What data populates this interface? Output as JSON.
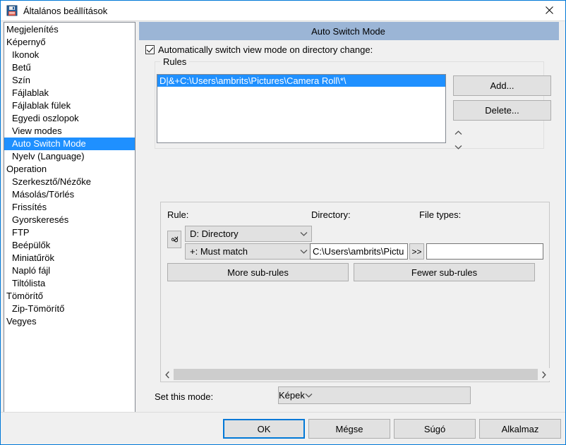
{
  "window": {
    "title": "Általános beállítások",
    "icon": "save-floppy-icon",
    "close_label": "✕"
  },
  "sidebar": {
    "items": [
      {
        "label": "Megjelenítés",
        "level": 0,
        "selected": false
      },
      {
        "label": "Képernyő",
        "level": 0,
        "selected": false
      },
      {
        "label": "Ikonok",
        "level": 1,
        "selected": false
      },
      {
        "label": "Betű",
        "level": 1,
        "selected": false
      },
      {
        "label": "Szín",
        "level": 1,
        "selected": false
      },
      {
        "label": "Fájlablak",
        "level": 1,
        "selected": false
      },
      {
        "label": "Fájlablak fülek",
        "level": 1,
        "selected": false
      },
      {
        "label": "Egyedi oszlopok",
        "level": 1,
        "selected": false
      },
      {
        "label": "View modes",
        "level": 1,
        "selected": false
      },
      {
        "label": "Auto Switch Mode",
        "level": 1,
        "selected": true
      },
      {
        "label": "Nyelv (Language)",
        "level": 1,
        "selected": false
      },
      {
        "label": "Operation",
        "level": 0,
        "selected": false
      },
      {
        "label": "Szerkesztő/Nézőke",
        "level": 1,
        "selected": false
      },
      {
        "label": "Másolás/Törlés",
        "level": 1,
        "selected": false
      },
      {
        "label": "Frissítés",
        "level": 1,
        "selected": false
      },
      {
        "label": "Gyorskeresés",
        "level": 1,
        "selected": false
      },
      {
        "label": "FTP",
        "level": 1,
        "selected": false
      },
      {
        "label": "Beépülők",
        "level": 1,
        "selected": false
      },
      {
        "label": "Miniatűrök",
        "level": 1,
        "selected": false
      },
      {
        "label": "Napló fájl",
        "level": 1,
        "selected": false
      },
      {
        "label": "Tiltólista",
        "level": 1,
        "selected": false
      },
      {
        "label": "Tömörítő",
        "level": 0,
        "selected": false
      },
      {
        "label": "Zip-Tömörítő",
        "level": 1,
        "selected": false
      },
      {
        "label": "Vegyes",
        "level": 0,
        "selected": false
      }
    ]
  },
  "pane": {
    "header_title": "Auto Switch Mode",
    "auto_switch_checkbox": {
      "label": "Automatically switch view mode on directory change:",
      "checked": true
    },
    "rules_group": {
      "legend": "Rules",
      "items": [
        {
          "text": "D|&+C:\\Users\\ambrits\\Pictures\\Camera Roll\\*\\",
          "selected": true
        }
      ],
      "add_label": "Add...",
      "delete_label": "Delete...",
      "move_up_icon": "chevron-up-icon",
      "move_down_icon": "chevron-down-icon"
    },
    "editor": {
      "rule_label": "Rule:",
      "directory_label": "Directory:",
      "file_types_label": "File types:",
      "and_button": "&",
      "rule_type_value": "D: Directory",
      "match_type_value": "+: Must match",
      "directory_value": "C:\\Users\\ambrits\\Pictu",
      "browse_label": ">>",
      "file_types_value": "",
      "more_sub_rules_label": "More sub-rules",
      "fewer_sub_rules_label": "Fewer sub-rules",
      "scroll_left_icon": "chevron-left-icon",
      "scroll_right_icon": "chevron-right-icon"
    },
    "set_mode": {
      "label": "Set this mode:",
      "value": "Képek"
    }
  },
  "bottom_bar": {
    "ok_label": "OK",
    "cancel_label": "Mégse",
    "help_label": "Súgó",
    "apply_label": "Alkalmaz"
  },
  "colors": {
    "header_blue": "#9bb5d6",
    "selection_blue": "#1f90ff",
    "focus_blue": "#0078d7",
    "dialog_bg": "#f0f0f0"
  }
}
